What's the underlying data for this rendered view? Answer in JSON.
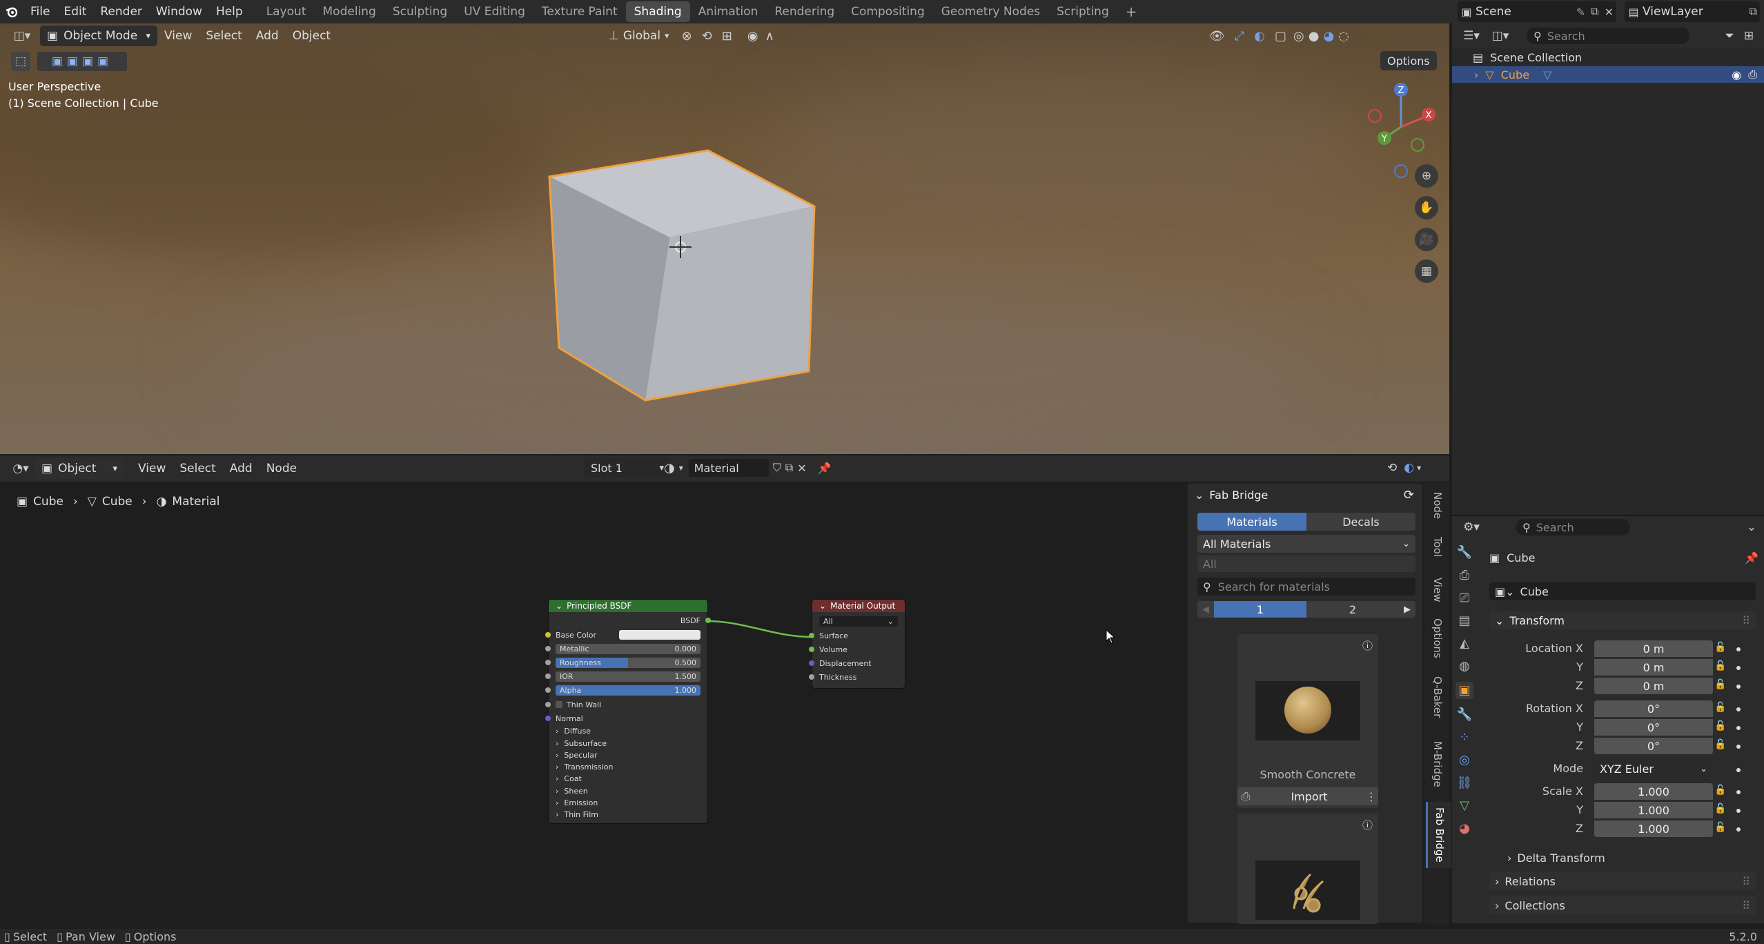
{
  "topbar": {
    "menu": [
      "File",
      "Edit",
      "Render",
      "Window",
      "Help"
    ],
    "workspaces": [
      "Layout",
      "Modeling",
      "Sculpting",
      "UV Editing",
      "Texture Paint",
      "Shading",
      "Animation",
      "Rendering",
      "Compositing",
      "Geometry Nodes",
      "Scripting"
    ],
    "active_workspace": "Shading",
    "add_tab": "+",
    "scene": "Scene",
    "view_layer": "ViewLayer"
  },
  "viewport": {
    "mode": "Object Mode",
    "menu": [
      "View",
      "Select",
      "Add",
      "Object"
    ],
    "orientation": "Global",
    "options": "Options",
    "overlay_title": "User Perspective",
    "overlay_sub": "(1) Scene Collection | Cube",
    "gizmo": {
      "x": "X",
      "y": "Y",
      "z": "Z"
    }
  },
  "node_editor": {
    "type": "Object",
    "menu": [
      "View",
      "Select",
      "Add",
      "Node"
    ],
    "slot": "Slot 1",
    "material": "Material",
    "breadcrumb": [
      "Cube",
      "Cube",
      "Material"
    ],
    "principled": {
      "title": "Principled BSDF",
      "out": "BSDF",
      "base_color": "Base Color",
      "fields": [
        {
          "label": "Metallic",
          "value": "0.000",
          "pct": 0
        },
        {
          "label": "Roughness",
          "value": "0.500",
          "pct": 50
        },
        {
          "label": "IOR",
          "value": "1.500",
          "pct": 0
        },
        {
          "label": "Alpha",
          "value": "1.000",
          "pct": 100
        }
      ],
      "thin_wall": "Thin Wall",
      "normal": "Normal",
      "panels": [
        "Diffuse",
        "Subsurface",
        "Specular",
        "Transmission",
        "Coat",
        "Sheen",
        "Emission",
        "Thin Film"
      ]
    },
    "output": {
      "title": "Material Output",
      "target": "All",
      "inputs": [
        "Surface",
        "Volume",
        "Displacement",
        "Thickness"
      ]
    },
    "side_tabs": [
      "Node",
      "Tool",
      "View",
      "Options",
      "Q-Baker",
      "M-Bridge",
      "Fab Bridge"
    ]
  },
  "fab_bridge": {
    "title": "Fab Bridge",
    "tabs": [
      "Materials",
      "Decals"
    ],
    "active_tab": "Materials",
    "filter": "All Materials",
    "subfilter": "All",
    "search_placeholder": "Search for materials",
    "pages": [
      "1",
      "2"
    ],
    "active_page": "1",
    "items": [
      {
        "name": "Smooth Concrete",
        "action": "Import"
      },
      {
        "name": "",
        "action": ""
      }
    ]
  },
  "outliner": {
    "search_placeholder": "Search",
    "root": "Scene Collection",
    "items": [
      {
        "name": "Cube"
      }
    ]
  },
  "properties": {
    "search_placeholder": "Search",
    "object_name": "Cube",
    "object_field": "Cube",
    "transform_title": "Transform",
    "location": {
      "label": "Location X",
      "x": "0 m",
      "y": "0 m",
      "z": "0 m"
    },
    "rotation": {
      "label": "Rotation X",
      "x": "0°",
      "y": "0°",
      "z": "0°"
    },
    "mode_label": "Mode",
    "mode": "XYZ Euler",
    "scale": {
      "label": "Scale X",
      "x": "1.000",
      "y": "1.000",
      "z": "1.000"
    },
    "axis_y": "Y",
    "axis_z": "Z",
    "sections": [
      "Delta Transform",
      "Relations",
      "Collections"
    ]
  },
  "statusbar": {
    "items": [
      "Select",
      "Pan View",
      "Options"
    ],
    "version": "5.2.0"
  },
  "colors": {
    "accent": "#4772b3",
    "selection": "#f0a040",
    "node_green": "#2e6e2e",
    "node_red": "#6e2e2e"
  }
}
